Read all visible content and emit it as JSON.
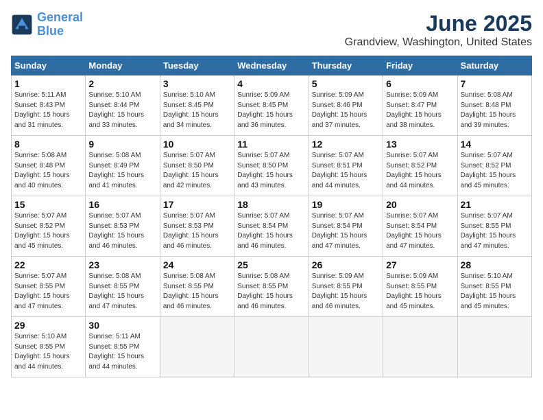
{
  "header": {
    "logo_line1": "General",
    "logo_line2": "Blue",
    "title": "June 2025",
    "subtitle": "Grandview, Washington, United States"
  },
  "days_of_week": [
    "Sunday",
    "Monday",
    "Tuesday",
    "Wednesday",
    "Thursday",
    "Friday",
    "Saturday"
  ],
  "weeks": [
    [
      {
        "day": "1",
        "sunrise": "Sunrise: 5:11 AM",
        "sunset": "Sunset: 8:43 PM",
        "daylight": "Daylight: 15 hours and 31 minutes."
      },
      {
        "day": "2",
        "sunrise": "Sunrise: 5:10 AM",
        "sunset": "Sunset: 8:44 PM",
        "daylight": "Daylight: 15 hours and 33 minutes."
      },
      {
        "day": "3",
        "sunrise": "Sunrise: 5:10 AM",
        "sunset": "Sunset: 8:45 PM",
        "daylight": "Daylight: 15 hours and 34 minutes."
      },
      {
        "day": "4",
        "sunrise": "Sunrise: 5:09 AM",
        "sunset": "Sunset: 8:45 PM",
        "daylight": "Daylight: 15 hours and 36 minutes."
      },
      {
        "day": "5",
        "sunrise": "Sunrise: 5:09 AM",
        "sunset": "Sunset: 8:46 PM",
        "daylight": "Daylight: 15 hours and 37 minutes."
      },
      {
        "day": "6",
        "sunrise": "Sunrise: 5:09 AM",
        "sunset": "Sunset: 8:47 PM",
        "daylight": "Daylight: 15 hours and 38 minutes."
      },
      {
        "day": "7",
        "sunrise": "Sunrise: 5:08 AM",
        "sunset": "Sunset: 8:48 PM",
        "daylight": "Daylight: 15 hours and 39 minutes."
      }
    ],
    [
      {
        "day": "8",
        "sunrise": "Sunrise: 5:08 AM",
        "sunset": "Sunset: 8:48 PM",
        "daylight": "Daylight: 15 hours and 40 minutes."
      },
      {
        "day": "9",
        "sunrise": "Sunrise: 5:08 AM",
        "sunset": "Sunset: 8:49 PM",
        "daylight": "Daylight: 15 hours and 41 minutes."
      },
      {
        "day": "10",
        "sunrise": "Sunrise: 5:07 AM",
        "sunset": "Sunset: 8:50 PM",
        "daylight": "Daylight: 15 hours and 42 minutes."
      },
      {
        "day": "11",
        "sunrise": "Sunrise: 5:07 AM",
        "sunset": "Sunset: 8:50 PM",
        "daylight": "Daylight: 15 hours and 43 minutes."
      },
      {
        "day": "12",
        "sunrise": "Sunrise: 5:07 AM",
        "sunset": "Sunset: 8:51 PM",
        "daylight": "Daylight: 15 hours and 44 minutes."
      },
      {
        "day": "13",
        "sunrise": "Sunrise: 5:07 AM",
        "sunset": "Sunset: 8:52 PM",
        "daylight": "Daylight: 15 hours and 44 minutes."
      },
      {
        "day": "14",
        "sunrise": "Sunrise: 5:07 AM",
        "sunset": "Sunset: 8:52 PM",
        "daylight": "Daylight: 15 hours and 45 minutes."
      }
    ],
    [
      {
        "day": "15",
        "sunrise": "Sunrise: 5:07 AM",
        "sunset": "Sunset: 8:52 PM",
        "daylight": "Daylight: 15 hours and 45 minutes."
      },
      {
        "day": "16",
        "sunrise": "Sunrise: 5:07 AM",
        "sunset": "Sunset: 8:53 PM",
        "daylight": "Daylight: 15 hours and 46 minutes."
      },
      {
        "day": "17",
        "sunrise": "Sunrise: 5:07 AM",
        "sunset": "Sunset: 8:53 PM",
        "daylight": "Daylight: 15 hours and 46 minutes."
      },
      {
        "day": "18",
        "sunrise": "Sunrise: 5:07 AM",
        "sunset": "Sunset: 8:54 PM",
        "daylight": "Daylight: 15 hours and 46 minutes."
      },
      {
        "day": "19",
        "sunrise": "Sunrise: 5:07 AM",
        "sunset": "Sunset: 8:54 PM",
        "daylight": "Daylight: 15 hours and 47 minutes."
      },
      {
        "day": "20",
        "sunrise": "Sunrise: 5:07 AM",
        "sunset": "Sunset: 8:54 PM",
        "daylight": "Daylight: 15 hours and 47 minutes."
      },
      {
        "day": "21",
        "sunrise": "Sunrise: 5:07 AM",
        "sunset": "Sunset: 8:55 PM",
        "daylight": "Daylight: 15 hours and 47 minutes."
      }
    ],
    [
      {
        "day": "22",
        "sunrise": "Sunrise: 5:07 AM",
        "sunset": "Sunset: 8:55 PM",
        "daylight": "Daylight: 15 hours and 47 minutes."
      },
      {
        "day": "23",
        "sunrise": "Sunrise: 5:08 AM",
        "sunset": "Sunset: 8:55 PM",
        "daylight": "Daylight: 15 hours and 47 minutes."
      },
      {
        "day": "24",
        "sunrise": "Sunrise: 5:08 AM",
        "sunset": "Sunset: 8:55 PM",
        "daylight": "Daylight: 15 hours and 46 minutes."
      },
      {
        "day": "25",
        "sunrise": "Sunrise: 5:08 AM",
        "sunset": "Sunset: 8:55 PM",
        "daylight": "Daylight: 15 hours and 46 minutes."
      },
      {
        "day": "26",
        "sunrise": "Sunrise: 5:09 AM",
        "sunset": "Sunset: 8:55 PM",
        "daylight": "Daylight: 15 hours and 46 minutes."
      },
      {
        "day": "27",
        "sunrise": "Sunrise: 5:09 AM",
        "sunset": "Sunset: 8:55 PM",
        "daylight": "Daylight: 15 hours and 45 minutes."
      },
      {
        "day": "28",
        "sunrise": "Sunrise: 5:10 AM",
        "sunset": "Sunset: 8:55 PM",
        "daylight": "Daylight: 15 hours and 45 minutes."
      }
    ],
    [
      {
        "day": "29",
        "sunrise": "Sunrise: 5:10 AM",
        "sunset": "Sunset: 8:55 PM",
        "daylight": "Daylight: 15 hours and 44 minutes."
      },
      {
        "day": "30",
        "sunrise": "Sunrise: 5:11 AM",
        "sunset": "Sunset: 8:55 PM",
        "daylight": "Daylight: 15 hours and 44 minutes."
      },
      null,
      null,
      null,
      null,
      null
    ]
  ]
}
